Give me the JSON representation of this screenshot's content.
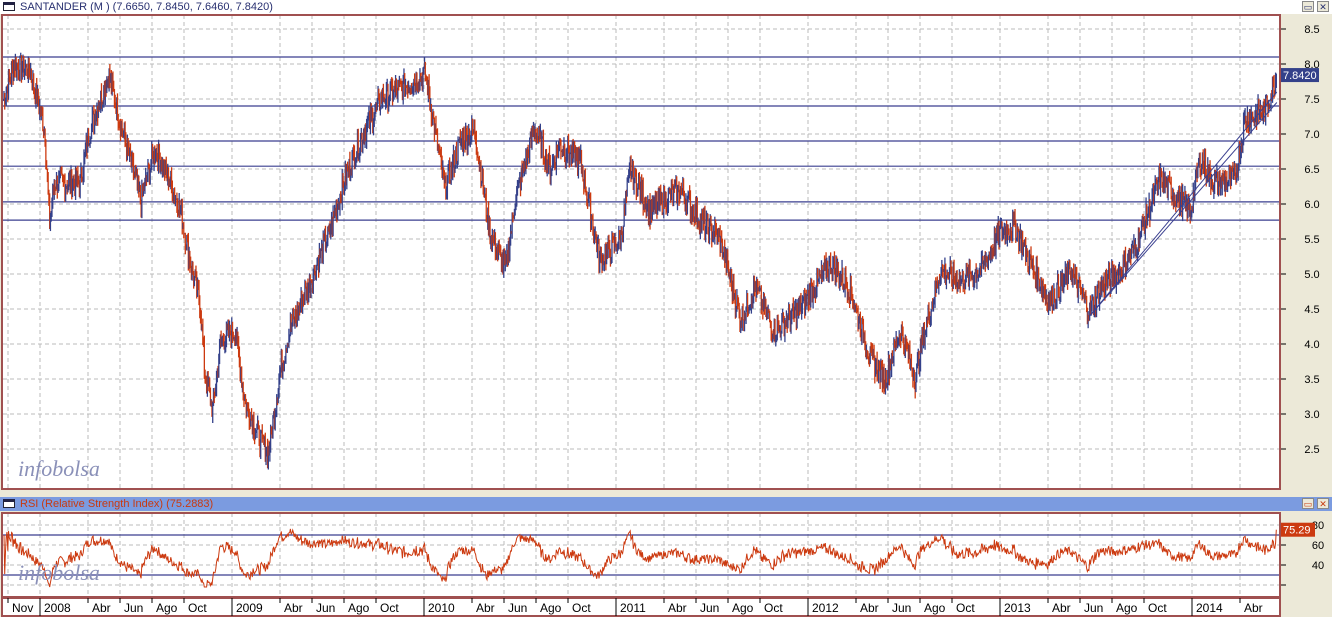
{
  "main_panel": {
    "title": "SANTANDER (M ) (7.6650, 7.8450, 7.6460, 7.8420)",
    "last_value": "7.8420",
    "watermark": "infobolsa",
    "minimize_icon": "minimize-icon",
    "close_icon": "close-icon"
  },
  "rsi_panel": {
    "title": "RSI (Relative Strength Index) (75.2883)",
    "last_value": "75.29",
    "watermark": "infobolsa"
  },
  "chart_data": [
    {
      "type": "line",
      "title": "SANTANDER (M )",
      "ylim": [
        2.2,
        8.7
      ],
      "yticks": [
        "2.5",
        "3.0",
        "3.5",
        "4.0",
        "4.5",
        "5.0",
        "5.5",
        "6.0",
        "6.5",
        "7.0",
        "7.5",
        "8.0",
        "8.5"
      ],
      "colors": {
        "up": "#34418a",
        "down": "#cc3a10",
        "hline": "#3a3f8f"
      },
      "hlines": [
        8.1,
        7.4,
        6.9,
        6.54,
        6.03,
        5.77
      ],
      "trendlines": [
        [
          [
            65.6,
            4.4
          ],
          [
            77.3,
            7.6
          ]
        ],
        [
          [
            65.6,
            4.4
          ],
          [
            77.3,
            7.45
          ]
        ]
      ],
      "t_months_since_jan2008": [
        -2.3,
        -1.6,
        -0.6,
        0.3,
        0.6,
        0.9,
        2.5,
        3.1,
        4.3,
        5,
        6.3,
        7.2,
        7.8,
        8.8,
        9.5,
        10,
        10.3,
        10.8,
        11.3,
        12.2,
        12.8,
        13.8,
        14.3,
        15,
        15.6,
        16.9,
        18.1,
        19.1,
        20,
        21.3,
        22.5,
        24.1,
        24.7,
        25.3,
        26.3,
        27.2,
        28.1,
        29.1,
        29.7,
        30.9,
        31.9,
        32.5,
        33.8,
        35,
        36.3,
        36.9,
        38.1,
        40,
        41.3,
        42.5,
        43.8,
        44.7,
        45.9,
        47.5,
        49.4,
        50.6,
        51.9,
        52.8,
        53.8,
        54.7,
        55.3,
        56.3,
        57.5,
        58.8,
        60,
        60.9,
        61.9,
        63.1,
        64.4,
        65.6,
        66.3,
        67.5,
        68.4,
        70,
        71.3,
        71.9,
        72.5,
        73.4,
        74.7,
        75.3,
        76.6,
        77.3
      ],
      "values": [
        7.5,
        8.0,
        7.9,
        7.05,
        5.7,
        6.3,
        6.3,
        7.05,
        7.85,
        7.2,
        6.05,
        6.8,
        6.5,
        5.9,
        5.05,
        4.6,
        3.6,
        3.05,
        4.05,
        4.2,
        3.2,
        2.6,
        2.45,
        3.6,
        4.2,
        4.9,
        5.6,
        6.4,
        6.9,
        7.5,
        7.65,
        7.85,
        7.05,
        6.2,
        6.9,
        7.05,
        5.6,
        5.05,
        6.05,
        7.1,
        6.5,
        6.85,
        6.6,
        5.2,
        5.5,
        6.5,
        5.9,
        6.2,
        5.75,
        5.5,
        4.35,
        4.8,
        4.2,
        4.5,
        5.15,
        4.8,
        3.8,
        3.5,
        4.2,
        3.5,
        4.2,
        5.05,
        4.9,
        5.05,
        5.6,
        5.7,
        5.15,
        4.6,
        5.05,
        4.45,
        4.8,
        5.05,
        5.35,
        6.35,
        6.05,
        5.9,
        6.65,
        6.3,
        6.35,
        7.2,
        7.35,
        7.84
      ]
    },
    {
      "type": "line",
      "title": "RSI (Relative Strength Index)",
      "ylim": [
        17,
        89
      ],
      "yticks": [
        "40",
        "60",
        "80"
      ],
      "hlines": [
        70,
        30
      ],
      "last": 75.2883,
      "color": "#cc3a10"
    }
  ],
  "x_axis": {
    "labels": [
      {
        "t": -2,
        "label": "Nov"
      },
      {
        "t": 0,
        "label": "2008",
        "year": true
      },
      {
        "t": 3,
        "label": "Abr"
      },
      {
        "t": 5,
        "label": "Jun"
      },
      {
        "t": 7,
        "label": "Ago"
      },
      {
        "t": 9,
        "label": "Oct"
      },
      {
        "t": 12,
        "label": "2009",
        "year": true
      },
      {
        "t": 15,
        "label": "Abr"
      },
      {
        "t": 17,
        "label": "Jun"
      },
      {
        "t": 19,
        "label": "Ago"
      },
      {
        "t": 21,
        "label": "Oct"
      },
      {
        "t": 24,
        "label": "2010",
        "year": true
      },
      {
        "t": 27,
        "label": "Abr"
      },
      {
        "t": 29,
        "label": "Jun"
      },
      {
        "t": 31,
        "label": "Ago"
      },
      {
        "t": 33,
        "label": "Oct"
      },
      {
        "t": 36,
        "label": "2011",
        "year": true
      },
      {
        "t": 39,
        "label": "Abr"
      },
      {
        "t": 41,
        "label": "Jun"
      },
      {
        "t": 43,
        "label": "Ago"
      },
      {
        "t": 45,
        "label": "Oct"
      },
      {
        "t": 48,
        "label": "2012",
        "year": true
      },
      {
        "t": 51,
        "label": "Abr"
      },
      {
        "t": 53,
        "label": "Jun"
      },
      {
        "t": 55,
        "label": "Ago"
      },
      {
        "t": 57,
        "label": "Oct"
      },
      {
        "t": 60,
        "label": "2013",
        "year": true
      },
      {
        "t": 63,
        "label": "Abr"
      },
      {
        "t": 65,
        "label": "Jun"
      },
      {
        "t": 67,
        "label": "Ago"
      },
      {
        "t": 69,
        "label": "Oct"
      },
      {
        "t": 72,
        "label": "2014",
        "year": true
      },
      {
        "t": 75,
        "label": "Abr"
      }
    ]
  }
}
